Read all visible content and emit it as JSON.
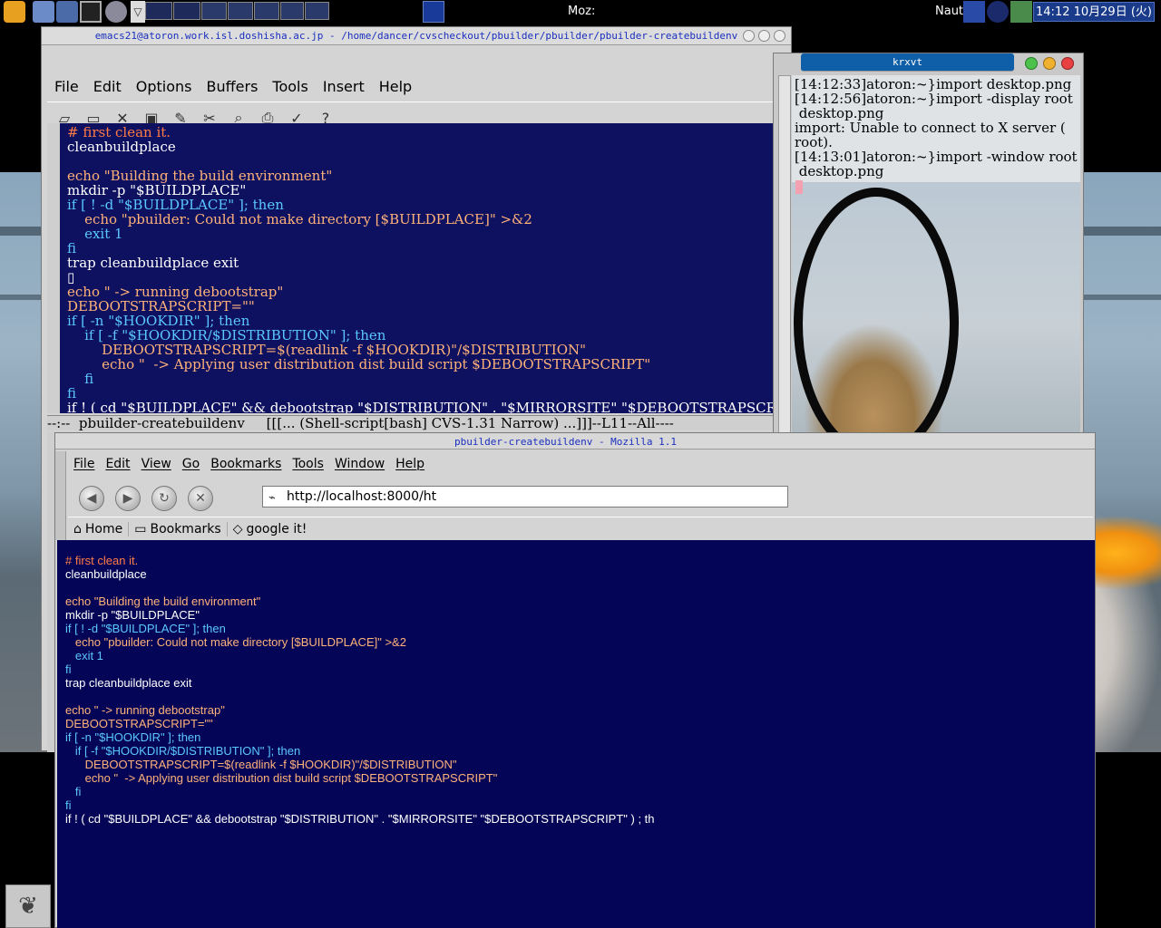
{
  "panel": {
    "clock": "14:12 10月29日 (火)",
    "moz_label": "Moz:",
    "naut_label": "Naut",
    "icons": [
      "gnome-foot-icon",
      "folder-icon",
      "book-icon",
      "terminal-icon",
      "gimp-icon",
      "pager-down-icon"
    ]
  },
  "emacs": {
    "title": "emacs21@atoron.work.isl.doshisha.ac.jp - /home/dancer/cvscheckout/pbuilder/pbuilder/pbuilder-createbuildenv",
    "menu": [
      "File",
      "Edit",
      "Options",
      "Buffers",
      "Tools",
      "Insert",
      "Help"
    ],
    "toolbar_icons": [
      "new-file-icon",
      "open-icon",
      "close-icon",
      "save-icon",
      "edit-icon",
      "cut-icon",
      "search-icon",
      "print-icon",
      "check-icon",
      "help-icon"
    ],
    "lines": [
      {
        "t": "# first clean it.",
        "c": "c-cm"
      },
      {
        "t": "cleanbuildplace",
        "c": "c-bf"
      },
      {
        "t": "",
        "c": "c-bf"
      },
      {
        "t": "echo \"Building the build environment\"",
        "c": "c-st"
      },
      {
        "t": "mkdir -p \"$BUILDPLACE\"",
        "c": "c-bf"
      },
      {
        "t": "if [ ! -d \"$BUILDPLACE\" ]; then",
        "c": "c-kw"
      },
      {
        "t": "    echo \"pbuilder: Could not make directory [$BUILDPLACE]\" >&2",
        "c": "c-st"
      },
      {
        "t": "    exit 1",
        "c": "c-kw"
      },
      {
        "t": "fi",
        "c": "c-kw"
      },
      {
        "t": "trap cleanbuildplace exit",
        "c": "c-bf"
      },
      {
        "t": "▯",
        "c": "c-bf"
      },
      {
        "t": "echo \" -> running debootstrap\"",
        "c": "c-st"
      },
      {
        "t": "DEBOOTSTRAPSCRIPT=\"\"",
        "c": "c-st"
      },
      {
        "t": "if [ -n \"$HOOKDIR\" ]; then",
        "c": "c-kw"
      },
      {
        "t": "    if [ -f \"$HOOKDIR/$DISTRIBUTION\" ]; then",
        "c": "c-kw"
      },
      {
        "t": "        DEBOOTSTRAPSCRIPT=$(readlink -f $HOOKDIR)\"/$DISTRIBUTION\"",
        "c": "c-st"
      },
      {
        "t": "        echo \"  -> Applying user distribution dist build script $DEBOOTSTRAPSCRIPT\"",
        "c": "c-st"
      },
      {
        "t": "    fi",
        "c": "c-kw"
      },
      {
        "t": "fi",
        "c": "c-kw"
      },
      {
        "t": "if ! ( cd \"$BUILDPLACE\" && debootstrap \"$DISTRIBUTION\" . \"$MIRRORSITE\" \"$DEBOOTSTRAPSCRIPT\" ) ; th",
        "c": "c-bf"
      }
    ],
    "modeline": "--:--  pbuilder-createbuildenv     [[[... (Shell-script[bash] CVS-1.31 Narrow) ...]]]--L11--All----"
  },
  "krxvt": {
    "title": "krxvt",
    "lines": [
      "[14:12:33]atoron:~}import desktop.png",
      "[14:12:56]atoron:~}import -display root",
      " desktop.png",
      "import: Unable to connect to X server (",
      "root).",
      "[14:13:01]atoron:~}import -window root",
      " desktop.png"
    ]
  },
  "mozilla": {
    "title": "pbuilder-createbuildenv - Mozilla 1.1",
    "menu": [
      "File",
      "Edit",
      "View",
      "Go",
      "Bookmarks",
      "Tools",
      "Window",
      "Help"
    ],
    "url": "http://localhost:8000/ht",
    "personal": [
      "Home",
      "Bookmarks",
      "google it!"
    ],
    "lines": [
      {
        "t": "# first clean it.",
        "c": "c-cm"
      },
      {
        "t": "cleanbuildplace",
        "c": "c-bf"
      },
      {
        "t": "",
        "c": "c-bf"
      },
      {
        "t": "echo \"Building the build environment\"",
        "c": "c-st"
      },
      {
        "t": "mkdir -p \"$BUILDPLACE\"",
        "c": "c-bf"
      },
      {
        "t": "if [ ! -d \"$BUILDPLACE\" ]; then",
        "c": "c-kw"
      },
      {
        "t": "   echo \"pbuilder: Could not make directory [$BUILDPLACE]\" >&2",
        "c": "c-st"
      },
      {
        "t": "   exit 1",
        "c": "c-kw"
      },
      {
        "t": "fi",
        "c": "c-kw"
      },
      {
        "t": "trap cleanbuildplace exit",
        "c": "c-bf"
      },
      {
        "t": "",
        "c": "c-bf"
      },
      {
        "t": "echo \" -> running debootstrap\"",
        "c": "c-st"
      },
      {
        "t": "DEBOOTSTRAPSCRIPT=\"\"",
        "c": "c-st"
      },
      {
        "t": "if [ -n \"$HOOKDIR\" ]; then",
        "c": "c-kw"
      },
      {
        "t": "   if [ -f \"$HOOKDIR/$DISTRIBUTION\" ]; then",
        "c": "c-kw"
      },
      {
        "t": "      DEBOOTSTRAPSCRIPT=$(readlink -f $HOOKDIR)\"/$DISTRIBUTION\"",
        "c": "c-st"
      },
      {
        "t": "      echo \"  -> Applying user distribution dist build script $DEBOOTSTRAPSCRIPT\"",
        "c": "c-st"
      },
      {
        "t": "   fi",
        "c": "c-kw"
      },
      {
        "t": "fi",
        "c": "c-kw"
      },
      {
        "t": "if ! ( cd \"$BUILDPLACE\" && debootstrap \"$DISTRIBUTION\" . \"$MIRRORSITE\" \"$DEBOOTSTRAPSCRIPT\" ) ; th",
        "c": "c-bf"
      }
    ]
  }
}
